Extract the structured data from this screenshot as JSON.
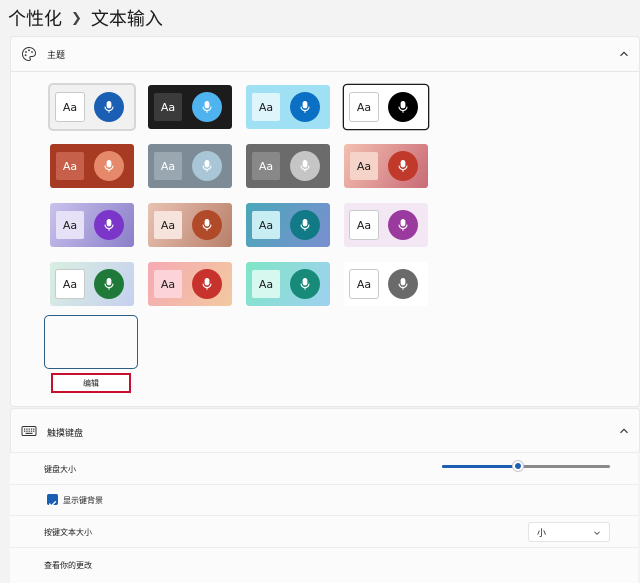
{
  "breadcrumb": {
    "parent": "个性化",
    "current": "文本输入"
  },
  "theme": {
    "title": "主题",
    "edit_label": "编辑",
    "tiles": [
      {
        "aa": "Aa",
        "bg": "#f1f1f1",
        "key": "#ffffff",
        "key_text": "#1b1b1b",
        "mic": "#1a5fb4",
        "selected": true
      },
      {
        "aa": "Aa",
        "bg": "#1c1c1c",
        "key": "#3b3b3b",
        "key_text": "#ffffff",
        "mic": "#4fb3ef"
      },
      {
        "aa": "Aa",
        "bg": "#9fe0f5",
        "key": "#dff5fc",
        "key_text": "#1b1b1b",
        "mic": "#0b6fc4"
      },
      {
        "aa": "Aa",
        "bg": "#ffffff",
        "key": "#ffffff",
        "key_text": "#1b1b1b",
        "mic": "#000000",
        "outlined": true
      },
      {
        "aa": "Aa",
        "bg": "#a63a22",
        "key": "#c6604b",
        "key_text": "#ffffff",
        "mic": "#e5896a"
      },
      {
        "aa": "Aa",
        "bg": "#7c8b96",
        "key": "#9aa7b0",
        "key_text": "#ffffff",
        "mic": "#a9c6d6"
      },
      {
        "aa": "Aa",
        "bg": "#6b6b6b",
        "key": "#888888",
        "key_text": "#ffffff",
        "mic": "#c5c5c5"
      },
      {
        "aa": "Aa",
        "bg": "#f2c0b0",
        "bg2": "#c96a76",
        "key": "#f5d3c8",
        "key_text": "#1b1b1b",
        "mic": "#c0392b"
      },
      {
        "aa": "Aa",
        "bg": "#c9c2ec",
        "bg2": "#8a7fc9",
        "key": "#e6e1f7",
        "key_text": "#1b1b1b",
        "mic": "#7b35c9"
      },
      {
        "aa": "Aa",
        "bg": "#e8c2b2",
        "bg2": "#b8806a",
        "key": "#f5e3dc",
        "key_text": "#1b1b1b",
        "mic": "#b04a28"
      },
      {
        "aa": "Aa",
        "bg": "#4aa7b8",
        "bg2": "#7a8fd0",
        "key": "#c8eef3",
        "key_text": "#1b1b1b",
        "mic": "#127a86"
      },
      {
        "aa": "Aa",
        "bg": "#f3e7f4",
        "key": "#ffffff",
        "key_text": "#1b1b1b",
        "mic": "#9b3a9e"
      },
      {
        "aa": "Aa",
        "bg": "#d9efe1",
        "bg2": "#c6d0ef",
        "key": "#ffffff",
        "key_text": "#1b1b1b",
        "mic": "#1f7a3a"
      },
      {
        "aa": "Aa",
        "bg": "#f6a9b3",
        "bg2": "#f2c9a0",
        "key": "#fbd3d8",
        "key_text": "#1b1b1b",
        "mic": "#c8322d"
      },
      {
        "aa": "Aa",
        "bg": "#7fe6c6",
        "bg2": "#9fd0f0",
        "key": "#d7f8ee",
        "key_text": "#1b1b1b",
        "mic": "#178a7a"
      },
      {
        "aa": "Aa",
        "bg": "#ffffff",
        "key": "#ffffff",
        "key_text": "#1b1b1b",
        "mic": "#6a6a6a",
        "custom": true
      }
    ]
  },
  "keyboard": {
    "title": "触摸键盘",
    "size_label": "键盘大小",
    "size_value": 0.45,
    "show_bg_label": "显示键背景",
    "show_bg_checked": true,
    "key_text_size_label": "按键文本大小",
    "key_text_size_value": "小",
    "view_changes_label": "查看你的更改"
  },
  "colors": {
    "accent": "#1a5fb4",
    "edit_border": "#c8102e"
  }
}
